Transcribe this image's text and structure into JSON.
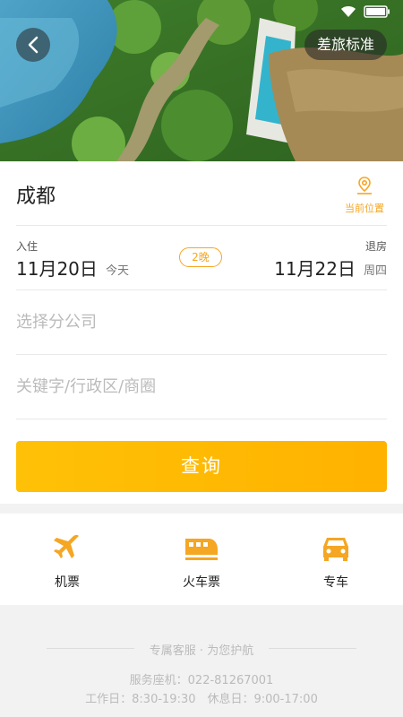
{
  "header": {
    "travel_standard_label": "差旅标准"
  },
  "search": {
    "city": "成都",
    "current_location_label": "当前位置",
    "checkin_label": "入住",
    "checkin_date": "11月20日",
    "checkin_day": "今天",
    "nights": "2晚",
    "checkout_label": "退房",
    "checkout_date": "11月22日",
    "checkout_day": "周四",
    "branch_placeholder": "选择分公司",
    "keyword_placeholder": "关键字/行政区/商圈",
    "submit_label": "查询"
  },
  "services": [
    {
      "label": "机票",
      "icon": "airplane-icon"
    },
    {
      "label": "火车票",
      "icon": "train-icon"
    },
    {
      "label": "专车",
      "icon": "car-icon"
    }
  ],
  "footer": {
    "title": "专属客服 · 为您护航",
    "phone": "服务座机：022-81267001",
    "hours": "工作日：8:30-19:30　休息日：9:00-17:00"
  },
  "colors": {
    "accent": "#f5a623",
    "button_gradient_start": "#ffc107",
    "button_gradient_end": "#ffb200"
  }
}
